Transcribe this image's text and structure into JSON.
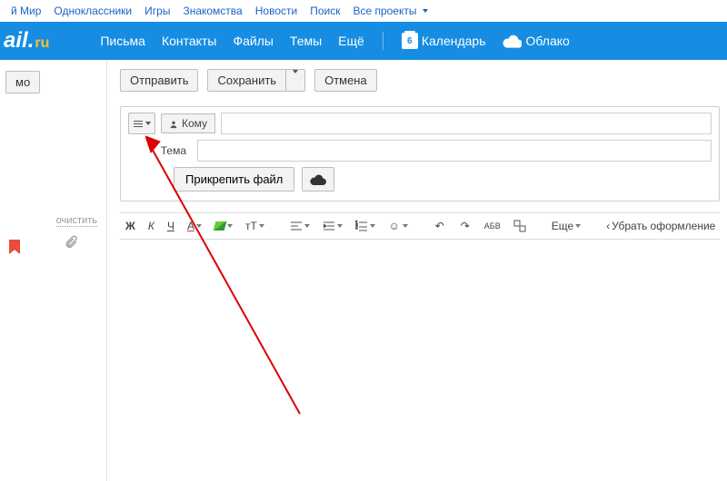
{
  "topbar": {
    "items": [
      "й Мир",
      "Одноклассники",
      "Игры",
      "Знакомства",
      "Новости",
      "Поиск"
    ],
    "all_projects": "Все проекты"
  },
  "logo": {
    "left": "ail",
    "dot": ".",
    "ru": "ru"
  },
  "nav": {
    "items": [
      "Письма",
      "Контакты",
      "Файлы",
      "Темы",
      "Ещё"
    ],
    "calendar_day": "6",
    "calendar": "Календарь",
    "cloud": "Облако"
  },
  "left": {
    "fragment_btn": "мо",
    "clear": "очистить"
  },
  "actions": {
    "send": "Отправить",
    "save": "Сохранить",
    "cancel": "Отмена"
  },
  "compose": {
    "to_label": "Кому",
    "subject_label": "Тема",
    "attach": "Прикрепить файл"
  },
  "format": {
    "bold": "Ж",
    "italic": "К",
    "underline": "Ч",
    "letterA": "A",
    "fontsize": "тT",
    "spellcheck": "АБВ",
    "more": "Еще",
    "remove_format": "Убрать оформление"
  }
}
